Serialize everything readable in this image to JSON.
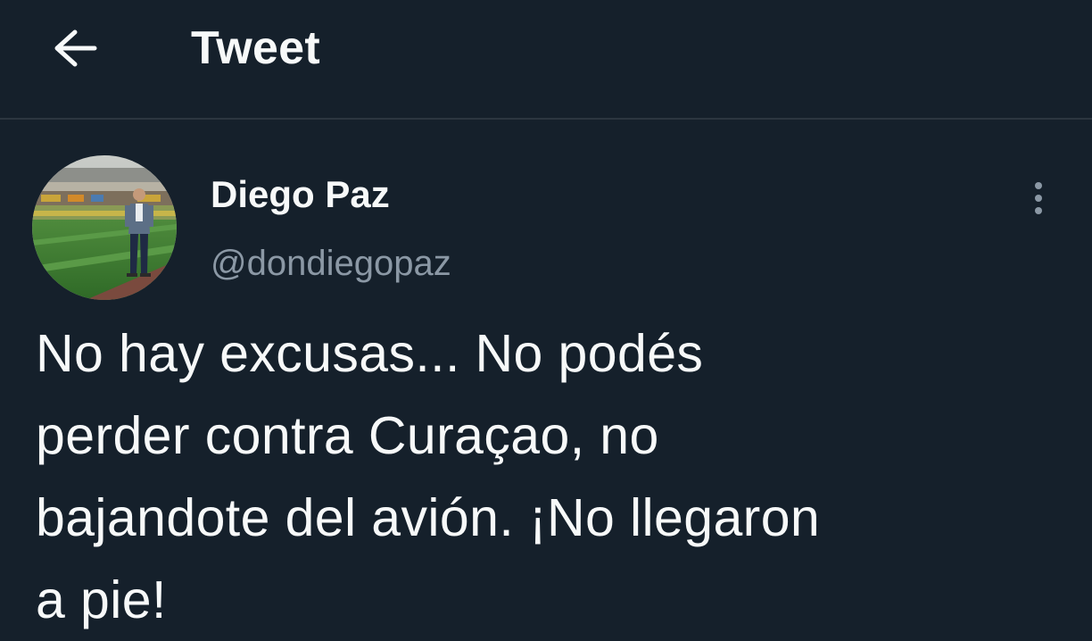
{
  "header": {
    "back_icon": "arrow-left-icon",
    "title": "Tweet"
  },
  "tweet": {
    "author": {
      "avatar_icon": "profile-photo-stadium",
      "name": "Diego Paz",
      "handle": "@dondiegopaz"
    },
    "more_icon": "more-vertical-icon",
    "text": "No hay excusas... No podés\nperder contra Curaçao, no\nbajandote del avión. ¡No llegaron\na pie!"
  },
  "colors": {
    "background": "#15202b",
    "text": "#f7f9f9",
    "secondary_text": "#8b98a5",
    "divider": "#2c3640"
  }
}
